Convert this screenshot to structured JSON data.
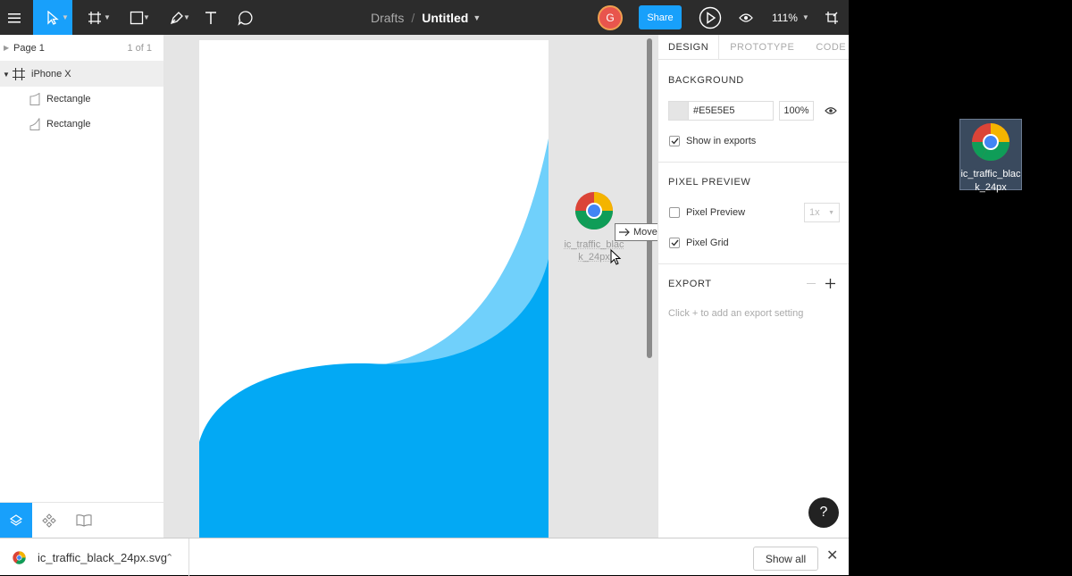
{
  "toolbar": {
    "breadcrumb_root": "Drafts",
    "breadcrumb_sep": "/",
    "file_title": "Untitled",
    "avatar_initial": "G",
    "share_label": "Share",
    "zoom_level": "111%"
  },
  "left_panel": {
    "page_name": "Page 1",
    "page_count": "1 of 1",
    "layers": [
      {
        "name": "iPhone X",
        "type": "frame"
      },
      {
        "name": "Rectangle",
        "type": "rectangle"
      },
      {
        "name": "Rectangle",
        "type": "rectangle"
      }
    ]
  },
  "canvas": {
    "drag_file_label": "ic_traffic_blac k_24px",
    "move_tip": "Move",
    "wave_colors": {
      "dark": "#03a9f4",
      "light": "#70d0fb"
    }
  },
  "right_panel": {
    "tabs": [
      "DESIGN",
      "PROTOTYPE",
      "CODE"
    ],
    "background_title": "BACKGROUND",
    "bg_hex": "#E5E5E5",
    "bg_opacity": "100%",
    "show_in_exports": "Show in exports",
    "pixel_preview_title": "PIXEL PREVIEW",
    "pixel_preview_label": "Pixel Preview",
    "pixel_preview_scale": "1x",
    "pixel_grid_label": "Pixel Grid",
    "export_title": "EXPORT",
    "export_hint": "Click + to add an export setting",
    "help": "?"
  },
  "desktop": {
    "icon_label": "ic_traffic_blac k_24px"
  },
  "download_bar": {
    "file_name": "ic_traffic_black_24px.svg",
    "show_all": "Show all"
  }
}
